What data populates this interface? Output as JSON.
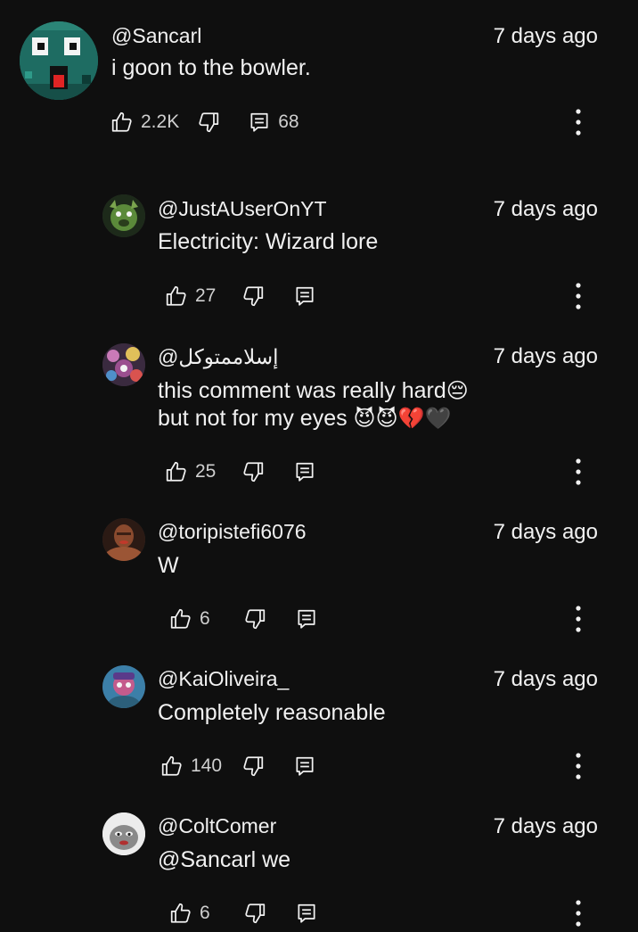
{
  "comments": [
    {
      "author": "@Sancarl",
      "time": "7 days ago",
      "lines": [
        "i goon to the bowler."
      ],
      "likes": "2.2K",
      "replies": "68"
    },
    {
      "author": "@JustAUserOnYT",
      "time": "7 days ago",
      "lines": [
        "Electricity: Wizard lore"
      ],
      "likes": "27"
    },
    {
      "author": "@إسلاممتوكل",
      "time": "7 days ago",
      "lines": [
        "this comment was really hard",
        "but not for my eyes "
      ],
      "emoji_1": "😔",
      "emoji_2": "😈😈💔🖤",
      "likes": "25"
    },
    {
      "author": "@toripistefi6076",
      "time": "7 days ago",
      "lines": [
        "W"
      ],
      "likes": "6"
    },
    {
      "author": "@KaiOliveira_",
      "time": "7 days ago",
      "lines": [
        "Completely reasonable"
      ],
      "likes": "140"
    },
    {
      "author": "@ColtComer",
      "time": "7 days ago",
      "lines": [
        "@Sancarl we"
      ],
      "likes": "6"
    }
  ],
  "icons": {
    "like": "thumb-up-icon",
    "dislike": "thumb-down-icon",
    "reply": "reply-icon",
    "more": "more-vertical-icon"
  }
}
